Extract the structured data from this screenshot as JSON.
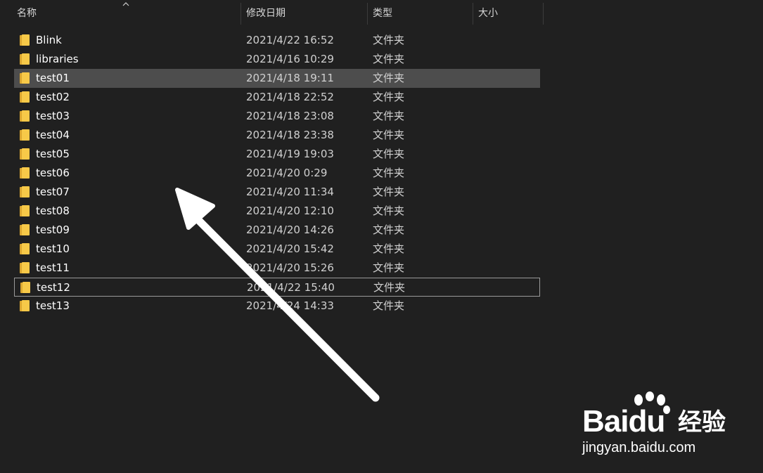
{
  "columns": {
    "name": "名称",
    "date": "修改日期",
    "type": "类型",
    "size": "大小"
  },
  "files": [
    {
      "name": "Blink",
      "date": "2021/4/22 16:52",
      "type": "文件夹",
      "state": "normal"
    },
    {
      "name": "libraries",
      "date": "2021/4/16 10:29",
      "type": "文件夹",
      "state": "normal"
    },
    {
      "name": "test01",
      "date": "2021/4/18 19:11",
      "type": "文件夹",
      "state": "selected"
    },
    {
      "name": "test02",
      "date": "2021/4/18 22:52",
      "type": "文件夹",
      "state": "normal"
    },
    {
      "name": "test03",
      "date": "2021/4/18 23:08",
      "type": "文件夹",
      "state": "normal"
    },
    {
      "name": "test04",
      "date": "2021/4/18 23:38",
      "type": "文件夹",
      "state": "normal"
    },
    {
      "name": "test05",
      "date": "2021/4/19 19:03",
      "type": "文件夹",
      "state": "normal"
    },
    {
      "name": "test06",
      "date": "2021/4/20 0:29",
      "type": "文件夹",
      "state": "normal"
    },
    {
      "name": "test07",
      "date": "2021/4/20 11:34",
      "type": "文件夹",
      "state": "normal"
    },
    {
      "name": "test08",
      "date": "2021/4/20 12:10",
      "type": "文件夹",
      "state": "normal"
    },
    {
      "name": "test09",
      "date": "2021/4/20 14:26",
      "type": "文件夹",
      "state": "normal"
    },
    {
      "name": "test10",
      "date": "2021/4/20 15:42",
      "type": "文件夹",
      "state": "normal"
    },
    {
      "name": "test11",
      "date": "2021/4/20 15:26",
      "type": "文件夹",
      "state": "normal"
    },
    {
      "name": "test12",
      "date": "2021/4/22 15:40",
      "type": "文件夹",
      "state": "focused"
    },
    {
      "name": "test13",
      "date": "2021/4/24 14:33",
      "type": "文件夹",
      "state": "normal"
    }
  ],
  "icons": {
    "folder": "folder-icon",
    "sort": "sort-ascending-icon",
    "annotation": "annotation-arrow-icon"
  },
  "colors": {
    "background": "#202020",
    "selected_row": "#4d4d4d",
    "folder_yellow": "#f7c948",
    "text": "#ffffff"
  },
  "watermark": {
    "logo": "Bai",
    "logo_suffix": "du",
    "cn": "经验",
    "url": "jingyan.baidu.com"
  }
}
